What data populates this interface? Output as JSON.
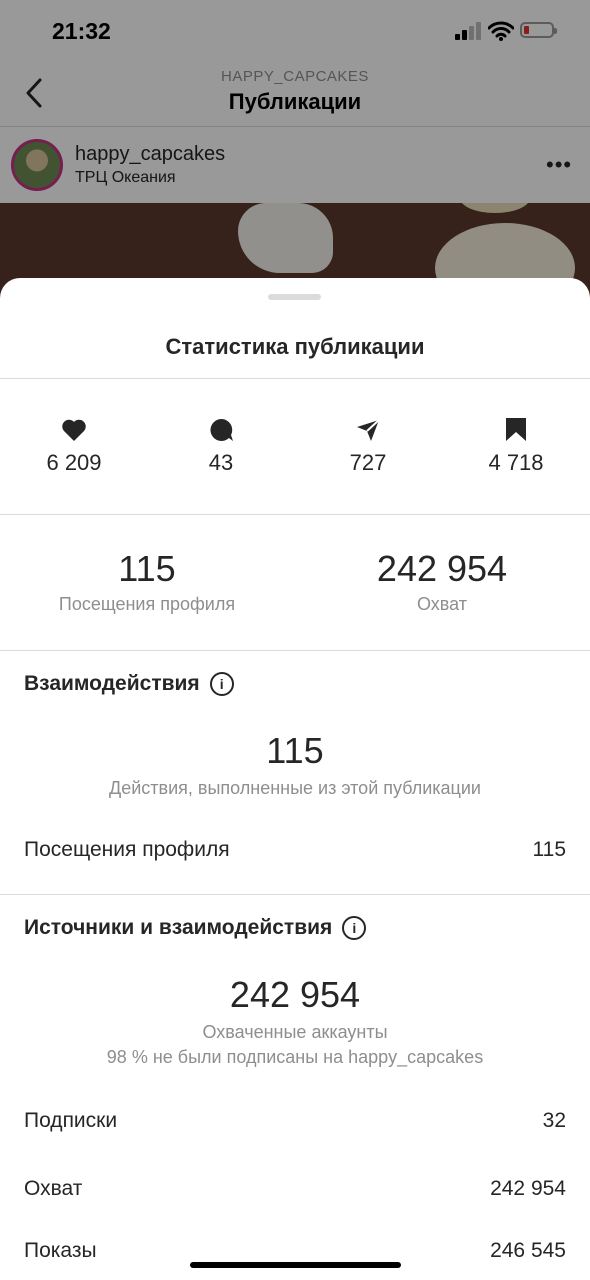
{
  "status_bar": {
    "time": "21:32"
  },
  "nav": {
    "subtitle": "HAPPY_CAPCAKES",
    "title": "Публикации"
  },
  "post": {
    "username": "happy_capcakes",
    "location": "ТРЦ Океания",
    "more": "•••"
  },
  "sheet": {
    "title": "Статистика публикации",
    "metrics": [
      {
        "icon": "heart-icon",
        "value": "6 209"
      },
      {
        "icon": "comment-icon",
        "value": "43"
      },
      {
        "icon": "send-icon",
        "value": "727"
      },
      {
        "icon": "bookmark-icon",
        "value": "4 718"
      }
    ],
    "summary": [
      {
        "value": "115",
        "label": "Посещения профиля"
      },
      {
        "value": "242 954",
        "label": "Охват"
      }
    ],
    "interactions": {
      "title": "Взаимодействия",
      "value": "115",
      "label": "Действия, выполненные из этой публикации",
      "rows": [
        {
          "label": "Посещения профиля",
          "value": "115"
        }
      ]
    },
    "discovery": {
      "title": "Источники и взаимодействия",
      "value": "242 954",
      "label": "Охваченные аккаунты",
      "note": "98 % не были подписаны на happy_capcakes",
      "rows": [
        {
          "label": "Подписки",
          "value": "32"
        },
        {
          "label": "Охват",
          "value": "242 954"
        },
        {
          "label": "Показы",
          "value": "246 545"
        }
      ]
    }
  },
  "colors": {
    "text": "#262626",
    "secondary": "#8e8e8e",
    "divider": "#dbdbdb",
    "battery_low": "#e0342f",
    "avatar_ring": "#c13584"
  }
}
